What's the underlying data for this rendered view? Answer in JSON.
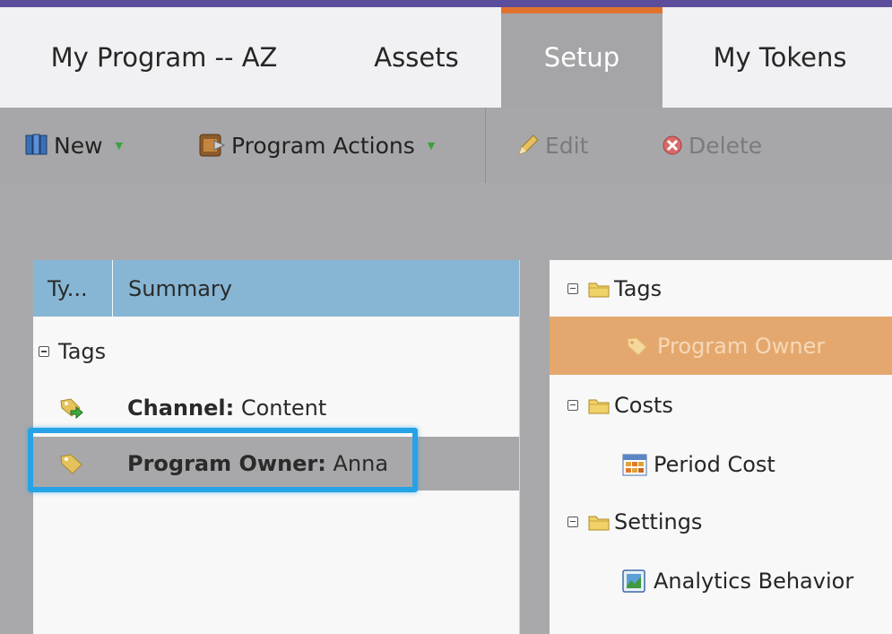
{
  "tabs": [
    {
      "label": "My Program -- AZ",
      "active": false
    },
    {
      "label": "Assets",
      "active": false
    },
    {
      "label": "Setup",
      "active": true
    },
    {
      "label": "My Tokens",
      "active": false
    }
  ],
  "toolbar": {
    "new_label": "New",
    "program_actions_label": "Program Actions",
    "edit_label": "Edit",
    "delete_label": "Delete"
  },
  "summary_table": {
    "col_type": "Ty...",
    "col_summary": "Summary",
    "group_label": "Tags",
    "rows": [
      {
        "key": "Channel:",
        "value": "Content",
        "icon": "tag-arrow-icon",
        "selected": false
      },
      {
        "key": "Program Owner:",
        "value": "Anna",
        "icon": "tag-icon",
        "selected": true
      }
    ]
  },
  "setup_tree": {
    "tags_label": "Tags",
    "program_owner_label": "Program Owner",
    "costs_label": "Costs",
    "period_cost_label": "Period Cost",
    "settings_label": "Settings",
    "analytics_label": "Analytics Behavior"
  },
  "colors": {
    "accent_tab": "#e0722e",
    "header_blue": "#87b6d4",
    "selection_orange": "#e4a86e",
    "highlight_blue": "#27a2e6"
  }
}
